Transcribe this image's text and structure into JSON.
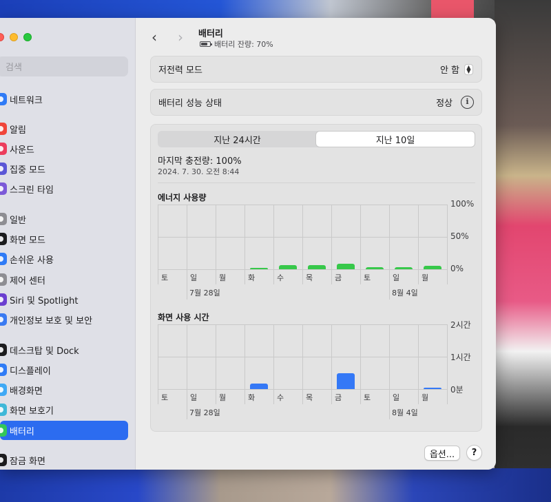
{
  "sidebar": {
    "search_placeholder": "검색",
    "items": [
      {
        "label": "네트워크",
        "icon": "globe-icon",
        "color": "#2f7bf6"
      },
      {
        "label": "알림",
        "icon": "bell-icon",
        "color": "#f0453a"
      },
      {
        "label": "사운드",
        "icon": "speaker-icon",
        "color": "#ec3d5c"
      },
      {
        "label": "집중 모드",
        "icon": "moon-icon",
        "color": "#5b57d6"
      },
      {
        "label": "스크린 타임",
        "icon": "hourglass-icon",
        "color": "#7c5ad8"
      },
      {
        "label": "일반",
        "icon": "gear-icon",
        "color": "#8e8e93"
      },
      {
        "label": "화면 모드",
        "icon": "appearance-icon",
        "color": "#1c1c1e"
      },
      {
        "label": "손쉬운 사용",
        "icon": "accessibility-icon",
        "color": "#2f7bf6"
      },
      {
        "label": "제어 센터",
        "icon": "control-center-icon",
        "color": "#8e8e93"
      },
      {
        "label": "Siri 및 Spotlight",
        "icon": "siri-icon",
        "color": "#6b3fd0"
      },
      {
        "label": "개인정보 보호 및 보안",
        "icon": "hand-icon",
        "color": "#3a7bf2"
      },
      {
        "label": "데스크탑 및 Dock",
        "icon": "dock-icon",
        "color": "#1c1c1e"
      },
      {
        "label": "디스플레이",
        "icon": "sun-icon",
        "color": "#2f7bf6"
      },
      {
        "label": "배경화면",
        "icon": "wallpaper-icon",
        "color": "#3fa9f5"
      },
      {
        "label": "화면 보호기",
        "icon": "screensaver-icon",
        "color": "#3fb8d8"
      },
      {
        "label": "배터리",
        "icon": "battery-icon",
        "color": "#34c759"
      },
      {
        "label": "잠금 화면",
        "icon": "lock-icon",
        "color": "#1c1c1e"
      }
    ],
    "selected_index": 15
  },
  "header": {
    "title": "배터리",
    "subtitle": "배터리 잔량: 70%"
  },
  "settings": {
    "low_power_label": "저전력 모드",
    "low_power_value": "안 함",
    "health_label": "배터리 성능 상태",
    "health_value": "정상"
  },
  "usage": {
    "tabs": [
      "지난 24시간",
      "지난 10일"
    ],
    "active_tab": 1,
    "last_charge": "마지막 충전량: 100%",
    "last_charge_time": "2024. 7. 30. 오전 8:44"
  },
  "chart_data": [
    {
      "type": "bar",
      "title": "에너지 사용량",
      "categories": [
        "토",
        "일",
        "월",
        "화",
        "수",
        "목",
        "금",
        "토",
        "일",
        "월"
      ],
      "values": [
        0,
        0,
        0,
        2,
        6,
        6,
        9,
        3,
        3,
        5
      ],
      "yticks": [
        "100%",
        "50%",
        "0%"
      ],
      "ylim": [
        0,
        100
      ],
      "date_labels": [
        {
          "label": "7월 28일",
          "index": 1
        },
        {
          "label": "8월 4일",
          "index": 8
        }
      ],
      "color": "#37c84a"
    },
    {
      "type": "bar",
      "title": "화면 사용 시간",
      "categories": [
        "토",
        "일",
        "월",
        "화",
        "수",
        "목",
        "금",
        "토",
        "일",
        "월"
      ],
      "values": [
        0,
        0,
        0,
        0.18,
        0,
        0,
        0.5,
        0,
        0,
        0.03
      ],
      "yticks": [
        "2시간",
        "1시간",
        "0분"
      ],
      "ylim": [
        0,
        2
      ],
      "unit": "hours",
      "date_labels": [
        {
          "label": "7월 28일",
          "index": 1
        },
        {
          "label": "8월 4일",
          "index": 8
        }
      ],
      "color": "#3478f6"
    }
  ],
  "footer": {
    "options_label": "옵션...",
    "help_label": "?"
  }
}
